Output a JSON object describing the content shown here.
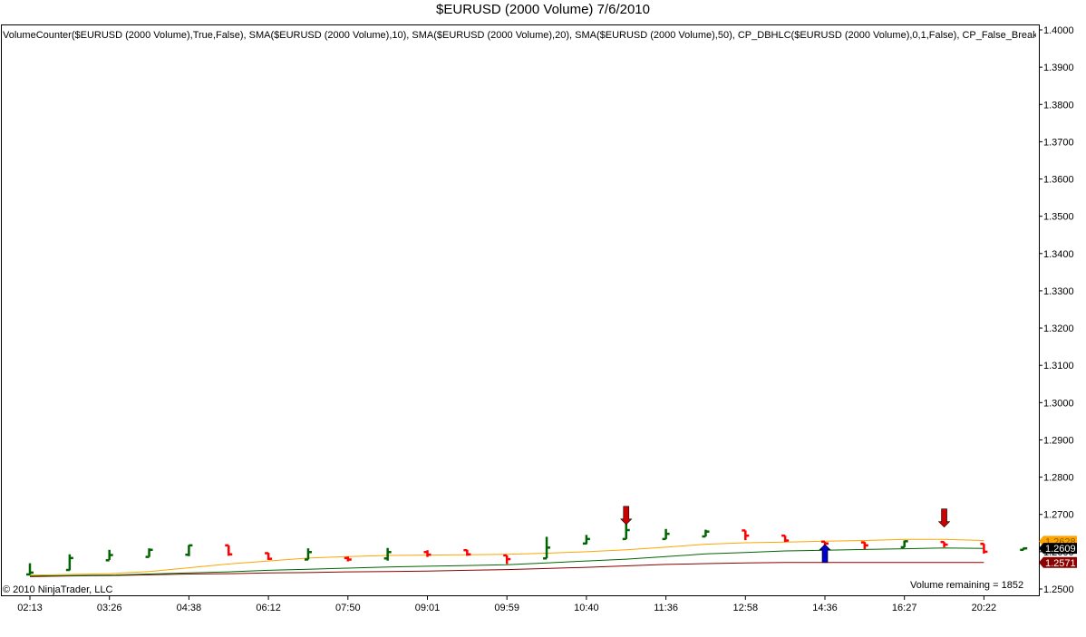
{
  "title": "$EURUSD (2000 Volume)  7/6/2010",
  "indicator_text": "VolumeCounter($EURUSD (2000 Volume),True,False), SMA($EURUSD (2000 Volume),10), SMA($EURUSD (2000 Volume),20), SMA($EURUSD (2000 Volume),50), CP_DBHLC($EURUSD (2000 Volume),0,1,False), CP_False_Break",
  "copyright": "© 2010 NinjaTrader, LLC",
  "volume_remaining": "Volume remaining = 1852",
  "colors": {
    "up_bar": "#006400",
    "down_bar": "#ff0000",
    "sma10": "#ffa500",
    "sma20": "#006400",
    "sma50": "#8b0000",
    "buy_arrow": "#0000cc",
    "sell_arrow": "#cc0000"
  },
  "chart_data": {
    "type": "ohlc",
    "ylim": [
      1.25,
      1.4
    ],
    "y_ticks": [
      "1.4000",
      "1.3900",
      "1.3800",
      "1.3700",
      "1.3600",
      "1.3500",
      "1.3400",
      "1.3300",
      "1.3200",
      "1.3100",
      "1.3000",
      "1.2900",
      "1.2800",
      "1.2700",
      "1.2600",
      "1.2500"
    ],
    "x_tick_labels": [
      "02:13",
      "03:26",
      "04:38",
      "06:12",
      "07:50",
      "09:01",
      "09:59",
      "10:40",
      "11:36",
      "12:58",
      "14:36",
      "16:27",
      "20:22"
    ],
    "x_tick_bar_index": [
      0,
      2,
      4,
      6,
      8,
      10,
      12,
      14,
      16,
      18,
      20,
      22,
      24
    ],
    "bars": [
      {
        "open": 1.2539,
        "high": 1.2569,
        "low": 1.2538,
        "close": 1.2544
      },
      {
        "open": 1.2551,
        "high": 1.2593,
        "low": 1.255,
        "close": 1.2583
      },
      {
        "open": 1.2577,
        "high": 1.2605,
        "low": 1.2578,
        "close": 1.2591
      },
      {
        "open": 1.2586,
        "high": 1.2609,
        "low": 1.2586,
        "close": 1.2605
      },
      {
        "open": 1.2592,
        "high": 1.2618,
        "low": 1.2588,
        "close": 1.2617
      },
      {
        "open": 1.2617,
        "high": 1.2617,
        "low": 1.2589,
        "close": 1.2593
      },
      {
        "open": 1.2596,
        "high": 1.2597,
        "low": 1.2578,
        "close": 1.2581
      },
      {
        "open": 1.2579,
        "high": 1.2609,
        "low": 1.2579,
        "close": 1.2599
      },
      {
        "open": 1.2583,
        "high": 1.2587,
        "low": 1.2574,
        "close": 1.2579
      },
      {
        "open": 1.2582,
        "high": 1.261,
        "low": 1.2576,
        "close": 1.2599
      },
      {
        "open": 1.2599,
        "high": 1.2604,
        "low": 1.2586,
        "close": 1.2592
      },
      {
        "open": 1.2604,
        "high": 1.2605,
        "low": 1.2589,
        "close": 1.2593
      },
      {
        "open": 1.259,
        "high": 1.259,
        "low": 1.2567,
        "close": 1.258
      },
      {
        "open": 1.2582,
        "high": 1.264,
        "low": 1.2582,
        "close": 1.2611
      },
      {
        "open": 1.2622,
        "high": 1.2645,
        "low": 1.262,
        "close": 1.2634
      },
      {
        "open": 1.2634,
        "high": 1.2675,
        "low": 1.2634,
        "close": 1.2658
      },
      {
        "open": 1.2634,
        "high": 1.2661,
        "low": 1.2634,
        "close": 1.2648
      },
      {
        "open": 1.2641,
        "high": 1.2659,
        "low": 1.2641,
        "close": 1.2654
      },
      {
        "open": 1.2657,
        "high": 1.2657,
        "low": 1.2631,
        "close": 1.2643
      },
      {
        "open": 1.2643,
        "high": 1.2643,
        "low": 1.2626,
        "close": 1.263
      },
      {
        "open": 1.2627,
        "high": 1.2627,
        "low": 1.2618,
        "close": 1.2622
      },
      {
        "open": 1.2625,
        "high": 1.2626,
        "low": 1.2607,
        "close": 1.2617
      },
      {
        "open": 1.2612,
        "high": 1.263,
        "low": 1.2612,
        "close": 1.2628
      },
      {
        "open": 1.2626,
        "high": 1.2626,
        "low": 1.2612,
        "close": 1.2619
      },
      {
        "open": 1.2621,
        "high": 1.2621,
        "low": 1.2595,
        "close": 1.26
      },
      {
        "open": 1.2605,
        "high": 1.2611,
        "low": 1.2605,
        "close": 1.2609
      }
    ],
    "sma10": [
      1.2537,
      1.2539,
      1.2541,
      1.2547,
      1.2557,
      1.2567,
      1.2575,
      1.2583,
      1.2587,
      1.259,
      1.2591,
      1.2592,
      1.2593,
      1.2596,
      1.26,
      1.2605,
      1.2612,
      1.262,
      1.2624,
      1.2626,
      1.2628,
      1.263,
      1.2633,
      1.2633,
      1.263
    ],
    "sma20": [
      1.2535,
      1.2536,
      1.2537,
      1.254,
      1.2543,
      1.2546,
      1.255,
      1.2553,
      1.2556,
      1.2559,
      1.2561,
      1.2563,
      1.2565,
      1.257,
      1.2575,
      1.258,
      1.2587,
      1.2594,
      1.2598,
      1.2602,
      1.2604,
      1.2606,
      1.2608,
      1.261,
      1.2609
    ],
    "sma50": [
      1.2533,
      1.2535,
      1.2536,
      1.2538,
      1.254,
      1.2541,
      1.2543,
      1.2544,
      1.2546,
      1.2547,
      1.2548,
      1.255,
      1.2552,
      1.2555,
      1.2558,
      1.2562,
      1.2566,
      1.2568,
      1.257,
      1.2571,
      1.2571,
      1.2571,
      1.2571,
      1.2571,
      1.2571
    ],
    "signals": [
      {
        "bar": 15,
        "type": "sell",
        "price": 1.2673
      },
      {
        "bar": 20,
        "type": "buy",
        "price": 1.2571
      },
      {
        "bar": 23,
        "type": "sell",
        "price": 1.2666
      }
    ],
    "price_tags": [
      {
        "label": "1.2628",
        "value": 1.2628,
        "color": "#ffa500",
        "text_color": "#8a5a00"
      },
      {
        "label": "1.2609",
        "value": 1.2609,
        "color": "#000000",
        "text_color": "#ffffff"
      },
      {
        "label": "1.2571",
        "value": 1.2571,
        "color": "#8b0000",
        "text_color": "#ffffff"
      }
    ]
  }
}
